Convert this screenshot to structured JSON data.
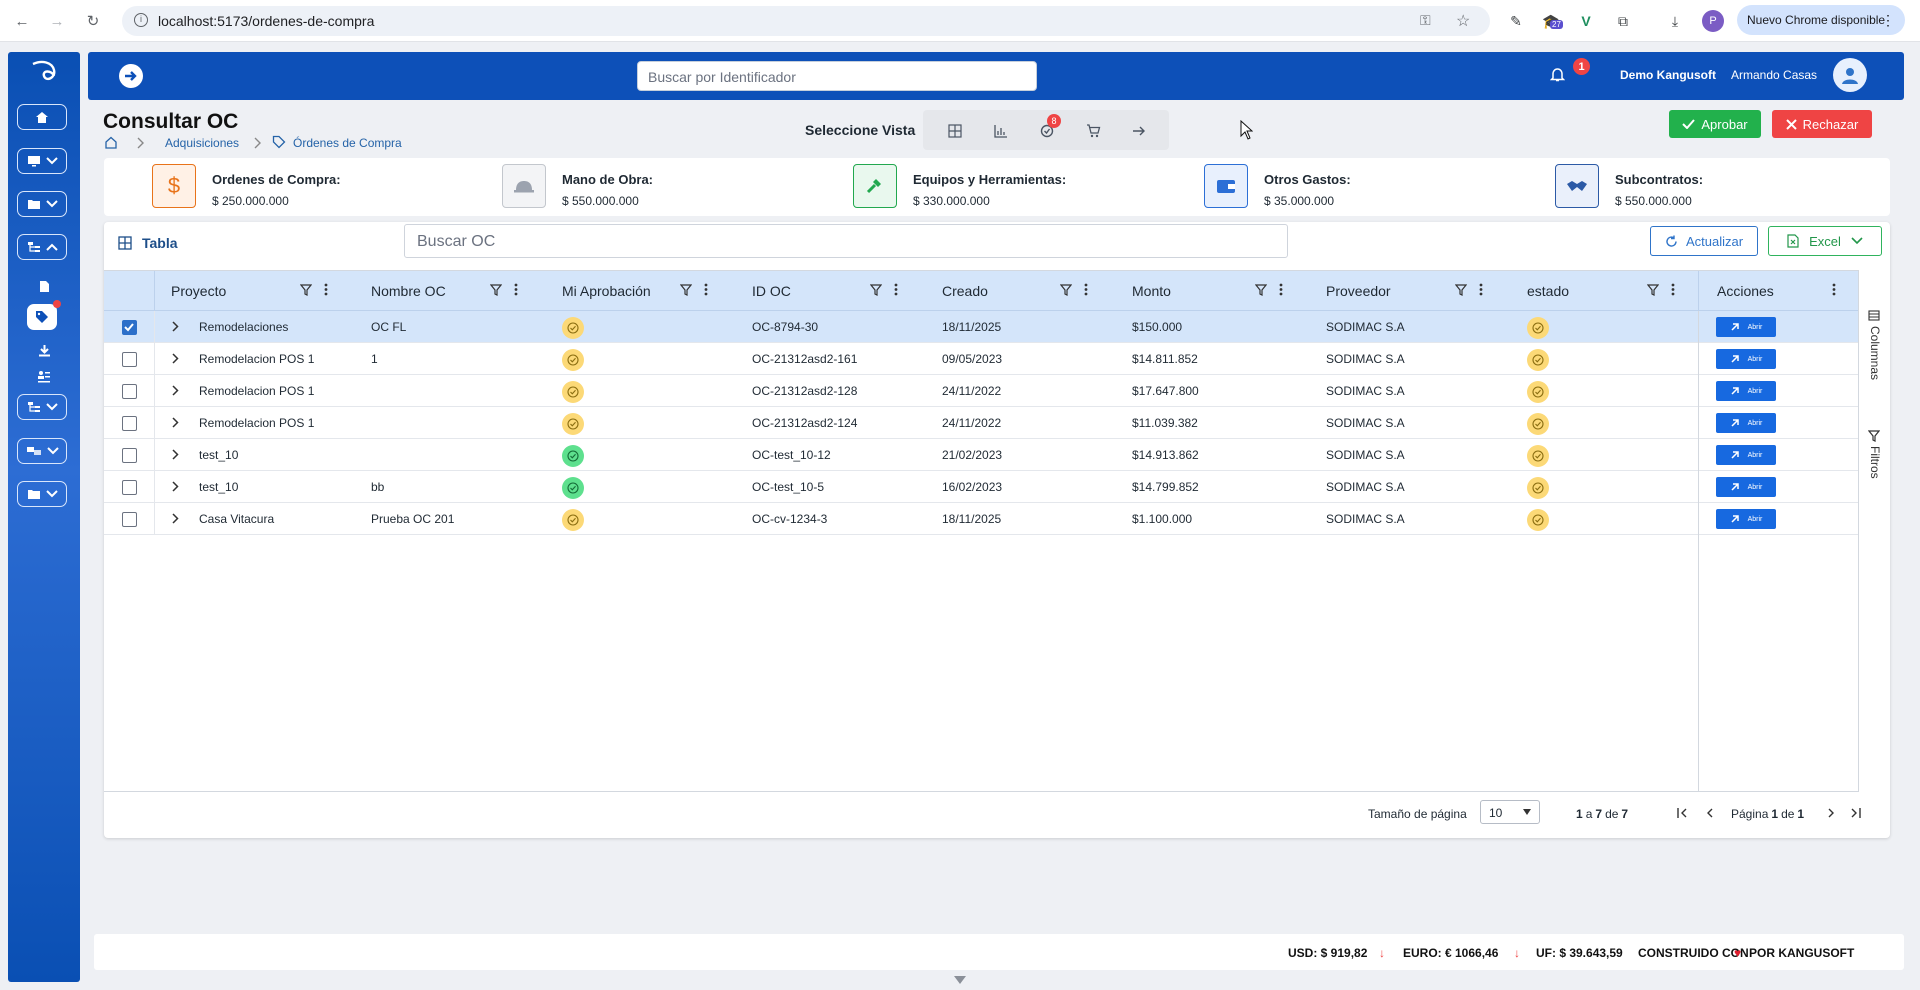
{
  "browser": {
    "url": "localhost:5173/ordenes-de-compra",
    "ext_badge": "27",
    "profile": "P",
    "update_label": "Nuevo Chrome disponible"
  },
  "topbar": {
    "search_placeholder": "Buscar por Identificador",
    "notification_count": "1",
    "company": "Demo Kangusoft",
    "user": "Armando Casas"
  },
  "page": {
    "title": "Consultar OC",
    "breadcrumb": [
      "Adquisiciones",
      "Órdenes de Compra"
    ],
    "vista_label": "Seleccione Vista",
    "vista_badge": "8",
    "approve_label": "Aprobar",
    "reject_label": "Rechazar"
  },
  "cards": [
    {
      "label": "Ordenes de Compra:",
      "value": "$ 250.000.000",
      "icon": "dollar-icon",
      "color": "#e8731a"
    },
    {
      "label": "Mano de Obra:",
      "value": "$ 550.000.000",
      "icon": "hardhat-icon",
      "color": "#9ca3af"
    },
    {
      "label": "Equipos y Herramientas:",
      "value": "$ 330.000.000",
      "icon": "hammer-icon",
      "color": "#22a84f"
    },
    {
      "label": "Otros Gastos:",
      "value": "$ 35.000.000",
      "icon": "wallet-icon",
      "color": "#2c6fd6"
    },
    {
      "label": "Subcontratos:",
      "value": "$ 550.000.000",
      "icon": "handshake-icon",
      "color": "#2c5aa6"
    }
  ],
  "table_toolbar": {
    "tab_label": "Tabla",
    "search_placeholder": "Buscar OC",
    "refresh_label": "Actualizar",
    "excel_label": "Excel"
  },
  "columns": [
    "Proyecto",
    "Nombre OC",
    "Mi Aprobación",
    "ID OC",
    "Creado",
    "Monto",
    "Proveedor",
    "estado",
    "Acciones"
  ],
  "rows": [
    {
      "selected": true,
      "proyecto": "Remodelaciones",
      "nombre": "OC FL",
      "aprobacion": "pending",
      "id": "OC-8794-30",
      "creado": "18/11/2025",
      "monto": "$150.000",
      "proveedor": "SODIMAC S.A",
      "estado": "pending"
    },
    {
      "selected": false,
      "proyecto": "Remodelacion POS 1",
      "nombre": "1",
      "aprobacion": "pending",
      "id": "OC-21312asd2-161",
      "creado": "09/05/2023",
      "monto": "$14.811.852",
      "proveedor": "SODIMAC S.A",
      "estado": "pending"
    },
    {
      "selected": false,
      "proyecto": "Remodelacion POS 1",
      "nombre": "",
      "aprobacion": "pending",
      "id": "OC-21312asd2-128",
      "creado": "24/11/2022",
      "monto": "$17.647.800",
      "proveedor": "SODIMAC S.A",
      "estado": "pending"
    },
    {
      "selected": false,
      "proyecto": "Remodelacion POS 1",
      "nombre": "",
      "aprobacion": "pending",
      "id": "OC-21312asd2-124",
      "creado": "24/11/2022",
      "monto": "$11.039.382",
      "proveedor": "SODIMAC S.A",
      "estado": "pending"
    },
    {
      "selected": false,
      "proyecto": "test_10",
      "nombre": "",
      "aprobacion": "approved",
      "id": "OC-test_10-12",
      "creado": "21/02/2023",
      "monto": "$14.913.862",
      "proveedor": "SODIMAC S.A",
      "estado": "pending"
    },
    {
      "selected": false,
      "proyecto": "test_10",
      "nombre": "bb",
      "aprobacion": "approved",
      "id": "OC-test_10-5",
      "creado": "16/02/2023",
      "monto": "$14.799.852",
      "proveedor": "SODIMAC S.A",
      "estado": "pending"
    },
    {
      "selected": false,
      "proyecto": "Casa Vitacura",
      "nombre": "Prueba OC 201",
      "aprobacion": "pending",
      "id": "OC-cv-1234-3",
      "creado": "18/11/2025",
      "monto": "$1.100.000",
      "proveedor": "SODIMAC S.A",
      "estado": "pending"
    }
  ],
  "row_action_label": "Abrir",
  "side_tools": {
    "columns_label": "Columnas",
    "filters_label": "Filtros"
  },
  "pagination": {
    "page_size_label": "Tamaño de página",
    "page_size": "10",
    "range_from": "1",
    "range_sep": "a",
    "range_to": "7",
    "range_of": "de",
    "range_total": "7",
    "page_label": "Página",
    "page_current": "1",
    "page_of": "de",
    "page_total": "1"
  },
  "footer": {
    "usd": "USD: $ 919,82",
    "euro": "EURO: € 1066,46",
    "uf": "UF: $ 39.643,59",
    "built_prefix": "CONSTRUIDO CON",
    "built_suffix": "POR KANGUSOFT"
  },
  "colors": {
    "primary": "#0d50b8",
    "approve": "#22b14c",
    "reject": "#ef4444",
    "pending": "#fcd977",
    "approved": "#5ee08e"
  }
}
